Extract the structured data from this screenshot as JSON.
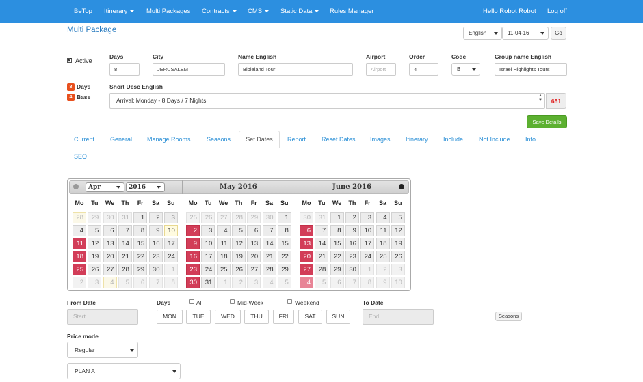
{
  "nav": {
    "brand": "BeTop",
    "items": [
      "Itinerary",
      "Multi Packages",
      "Contracts",
      "CMS",
      "Static Data",
      "Rules Manager"
    ],
    "user": "Hello Robot Robot",
    "logout": "Log off"
  },
  "page_title": "Multi Package",
  "toolbar": {
    "language": "English",
    "date": "11-04-16",
    "go": "Go"
  },
  "form": {
    "active_label": "Active",
    "days_label": "Days",
    "days_value": "8",
    "city_label": "City",
    "city_value": "JERUSALEM",
    "name_label": "Name English",
    "name_value": "Bibleland Tour",
    "airport_label": "Airport",
    "airport_placeholder": "Airport",
    "order_label": "Order",
    "order_value": "4",
    "code_label": "Code",
    "code_value": "B",
    "group_label": "Group name English",
    "group_value": "Israel Highlights Tours",
    "badge_days_count": "8",
    "badge_days_label": "Days",
    "badge_base_count": "4",
    "badge_base_label": "Base",
    "short_desc_label": "Short Desc English",
    "short_desc_value": "Arrival: Monday - 8 Days / 7 Nights",
    "char_count": "651",
    "save_button": "Save Details"
  },
  "tabs": [
    "Current",
    "General",
    "Manage Rooms",
    "Seasons",
    "Set Dates",
    "Report",
    "Reset Dates",
    "Images",
    "Itinerary",
    "Include",
    "Not Include",
    "Info",
    "SEO"
  ],
  "active_tab": "Set Dates",
  "calendar": {
    "month_select": "Apr",
    "year_select": "2016",
    "months": [
      "May 2016",
      "June 2016"
    ],
    "weekdays": [
      "Mo",
      "Tu",
      "We",
      "Th",
      "Fr",
      "Sa",
      "Su"
    ]
  },
  "dates": {
    "from_label": "From Date",
    "from_placeholder": "Start",
    "days_label": "Days",
    "check_all": "All",
    "check_mid": "Mid-Week",
    "check_weekend": "Weekend",
    "day_buttons": [
      "MON",
      "TUE",
      "WED",
      "THU",
      "FRI",
      "SAT",
      "SUN"
    ],
    "to_label": "To Date",
    "to_placeholder": "End",
    "seasons_button": "Seasons",
    "price_mode_label": "Price mode",
    "price_mode_value": "Regular",
    "plan_value": "PLAN A"
  },
  "colors": {
    "nav": "#2c8fe0",
    "highlight": "#d23d58",
    "save": "#5cb030",
    "badge": "#e8501e"
  }
}
